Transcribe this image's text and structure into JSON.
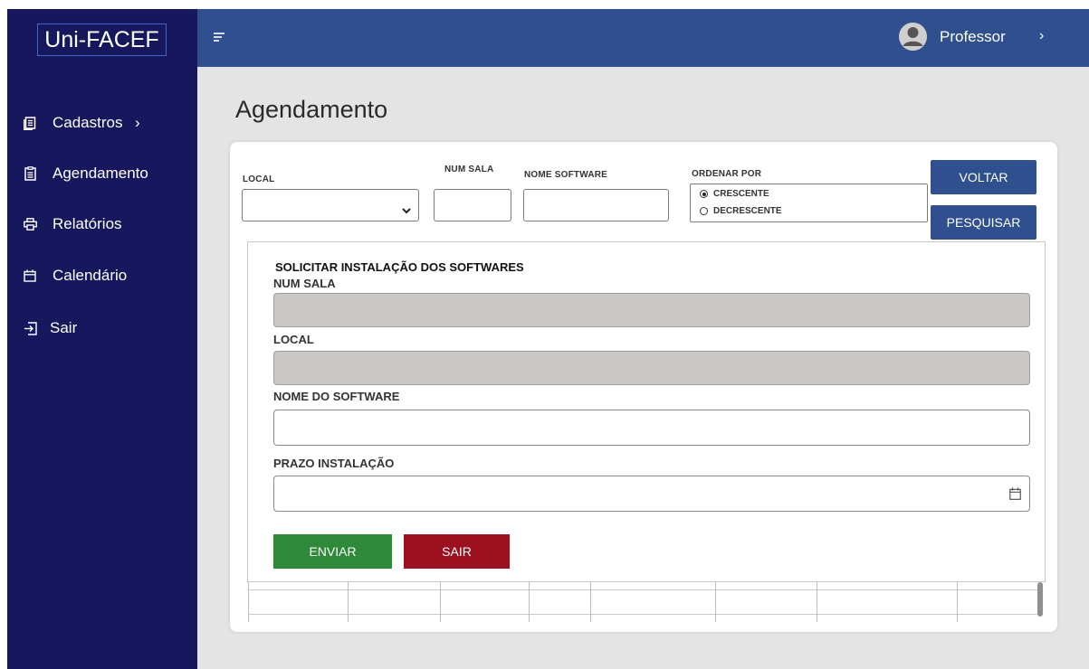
{
  "brand": "Uni-FACEF",
  "sidebar": {
    "items": [
      {
        "label": "Cadastros",
        "icon": "document-list-icon",
        "chevron": "›"
      },
      {
        "label": "Agendamento",
        "icon": "clipboard-icon"
      },
      {
        "label": "Relatórios",
        "icon": "printer-icon"
      },
      {
        "label": "Calendário",
        "icon": "calendar-icon"
      },
      {
        "label": "Sair",
        "icon": "logout-icon"
      }
    ]
  },
  "header": {
    "user_name": "Professor",
    "user_chevron": "›"
  },
  "page_title": "Agendamento",
  "filters": {
    "local_label": "LOCAL",
    "local_value": "",
    "num_sala_label": "NUM SALA",
    "num_sala_value": "",
    "nome_software_label": "NOME SOFTWARE",
    "nome_software_value": "",
    "ordenar_label": "ORDENAR POR",
    "ordenar_options": [
      "CRESCENTE",
      "DECRESCENTE"
    ],
    "ordenar_selected": "CRESCENTE",
    "voltar_label": "VOLTAR",
    "pesquisar_label": "PESQUISAR"
  },
  "modal": {
    "title": "SOLICITAR INSTALAÇÃO DOS SOFTWARES",
    "num_sala_label": "NUM SALA",
    "num_sala_value": "",
    "local_label": "LOCAL",
    "local_value": "",
    "nome_software_label": "NOME DO SOFTWARE",
    "nome_software_value": "",
    "prazo_label": "PRAZO INSTALAÇÃO",
    "prazo_value": "",
    "enviar_label": "ENVIAR",
    "sair_label": "SAIR"
  },
  "colors": {
    "sidebar": "#17175e",
    "topbar": "#2f4f8f",
    "primary_button": "#2f4f8f",
    "enviar_button": "#2e8a39",
    "sair_button": "#9c1020",
    "readonly_field": "#cbc7c7"
  }
}
